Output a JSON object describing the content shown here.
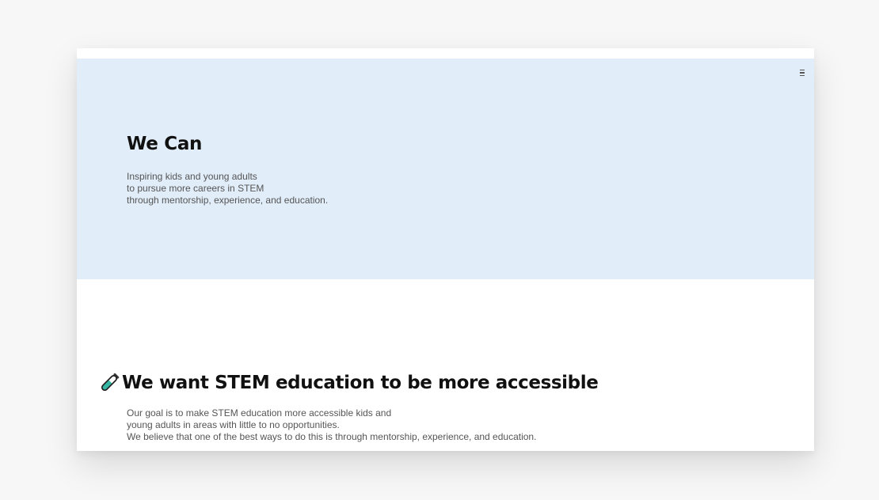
{
  "header": {
    "menu_icon": "hamburger-menu-icon"
  },
  "hero": {
    "title": "We Can",
    "subtitle_lines": [
      "Inspiring kids and young adults",
      "to pursue more careers in STEM",
      "through mentorship, experience, and education."
    ],
    "background": "#e1edf9"
  },
  "mission": {
    "icon": "test-tube-icon",
    "title": "We want STEM education to be more accessible",
    "body_lines": [
      "Our goal is to make STEM education more accessible kids and",
      "young adults in areas with little to no opportunities.",
      "We believe that one of the best ways to do this is through mentorship, experience, and education."
    ]
  }
}
